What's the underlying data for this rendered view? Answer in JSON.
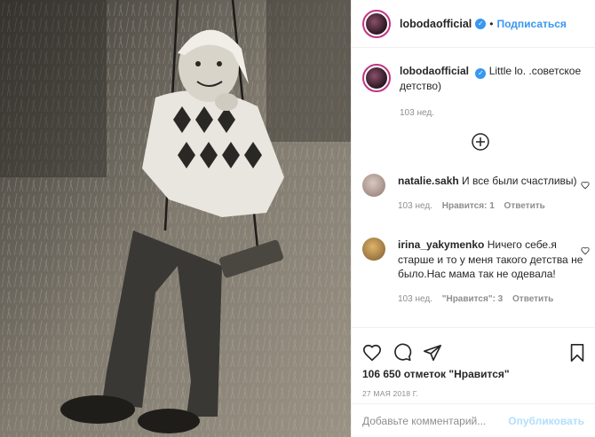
{
  "post": {
    "username": "lobodaofficial",
    "follow_label": "Подписаться",
    "dot": "•",
    "caption_text": "Little lo. .советское детство)",
    "caption_time": "103 нед."
  },
  "comments": [
    {
      "username": "natalie.sakh",
      "text": "И все были счастливы)",
      "time": "103 нед.",
      "likes": "Нравится: 1",
      "reply": "Ответить"
    },
    {
      "username": "irina_yakymenko",
      "text": "Ничего себе.я старше и то у меня такого детства не было.Нас мама так не одевала!",
      "time": "103 нед.",
      "likes": "\"Нравится\": 3",
      "reply": "Ответить"
    }
  ],
  "actions": {
    "likes": "106 650 отметок \"Нравится\"",
    "date": "27 МАЯ 2018 Г."
  },
  "compose": {
    "placeholder": "Добавьте комментарий...",
    "publish_label": "Опубликовать"
  },
  "icons": {
    "verified": "verified-badge-icon",
    "load_more": "plus-circle-icon",
    "like": "heart-icon",
    "comment": "comment-icon",
    "share": "share-icon",
    "save": "bookmark-icon"
  }
}
